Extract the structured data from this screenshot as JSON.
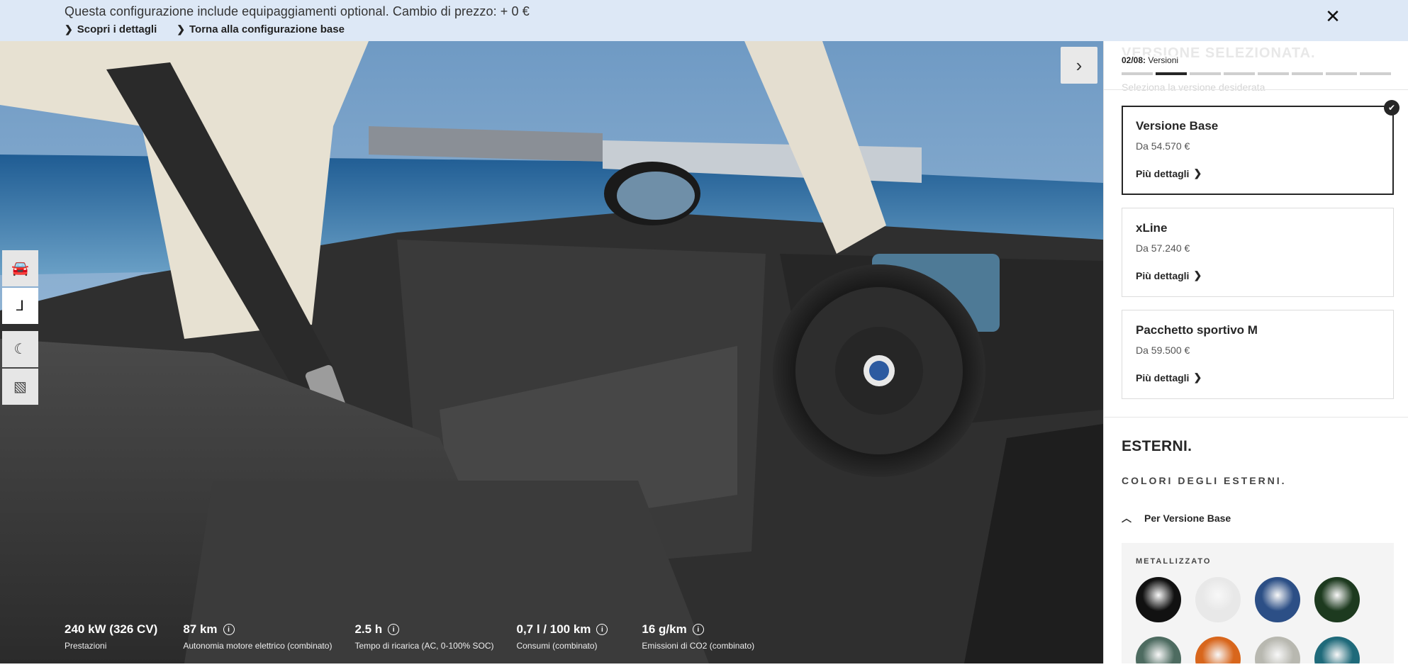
{
  "banner": {
    "text": "Questa configurazione include equipaggiamenti optional. Cambio di prezzo: + 0 €",
    "link_details": "Scopri i dettagli",
    "link_base": "Torna alla configurazione base",
    "close_glyph": "✕"
  },
  "viewer": {
    "next_glyph": "›",
    "tools": [
      {
        "name": "car-exterior-icon",
        "glyph": "🚘"
      },
      {
        "name": "seat-interior-icon",
        "glyph": "⅃"
      },
      {
        "name": "night-mode-icon",
        "glyph": "☾"
      },
      {
        "name": "background-image-icon",
        "glyph": "▧"
      }
    ],
    "specs": [
      {
        "value": "240 kW (326 CV)",
        "label": "Prestazioni",
        "info": false
      },
      {
        "value": "87 km",
        "label": "Autonomia motore elettrico (combinato)",
        "info": true
      },
      {
        "value": "2.5 h",
        "label": "Tempo di ricarica (AC, 0-100% SOC)",
        "info": true
      },
      {
        "value": "0,7 l / 100 km",
        "label": "Consumi (combinato)",
        "info": true
      },
      {
        "value": "16 g/km",
        "label": "Emissioni di CO2 (combinato)",
        "info": true
      }
    ]
  },
  "panel": {
    "ghost_title": "VERSIONE SELEZIONATA.",
    "ghost_sub": "Seleziona la versione desiderata",
    "step_number": "02/08:",
    "step_name": "Versioni",
    "progress": {
      "total": 8,
      "current": 2
    },
    "cards": [
      {
        "title": "Versione Base",
        "price": "Da 54.570 €",
        "more": "Più dettagli",
        "selected": true
      },
      {
        "title": "xLine",
        "price": "Da 57.240 €",
        "more": "Più dettagli",
        "selected": false
      },
      {
        "title": "Pacchetto sportivo M",
        "price": "Da 59.500 €",
        "more": "Più dettagli",
        "selected": false
      }
    ],
    "section_title": "ESTERNI.",
    "subsection": "COLORI DEGLI ESTERNI.",
    "accordion_label": "Per Versione Base",
    "swatch_group": "METALLIZZATO",
    "swatches": [
      "#111111",
      "#e8e8e8",
      "#2c4f86",
      "#1d3a1f",
      "#4d6b60",
      "#d8661c",
      "#b8b8b0",
      "#1f6a7a"
    ]
  }
}
